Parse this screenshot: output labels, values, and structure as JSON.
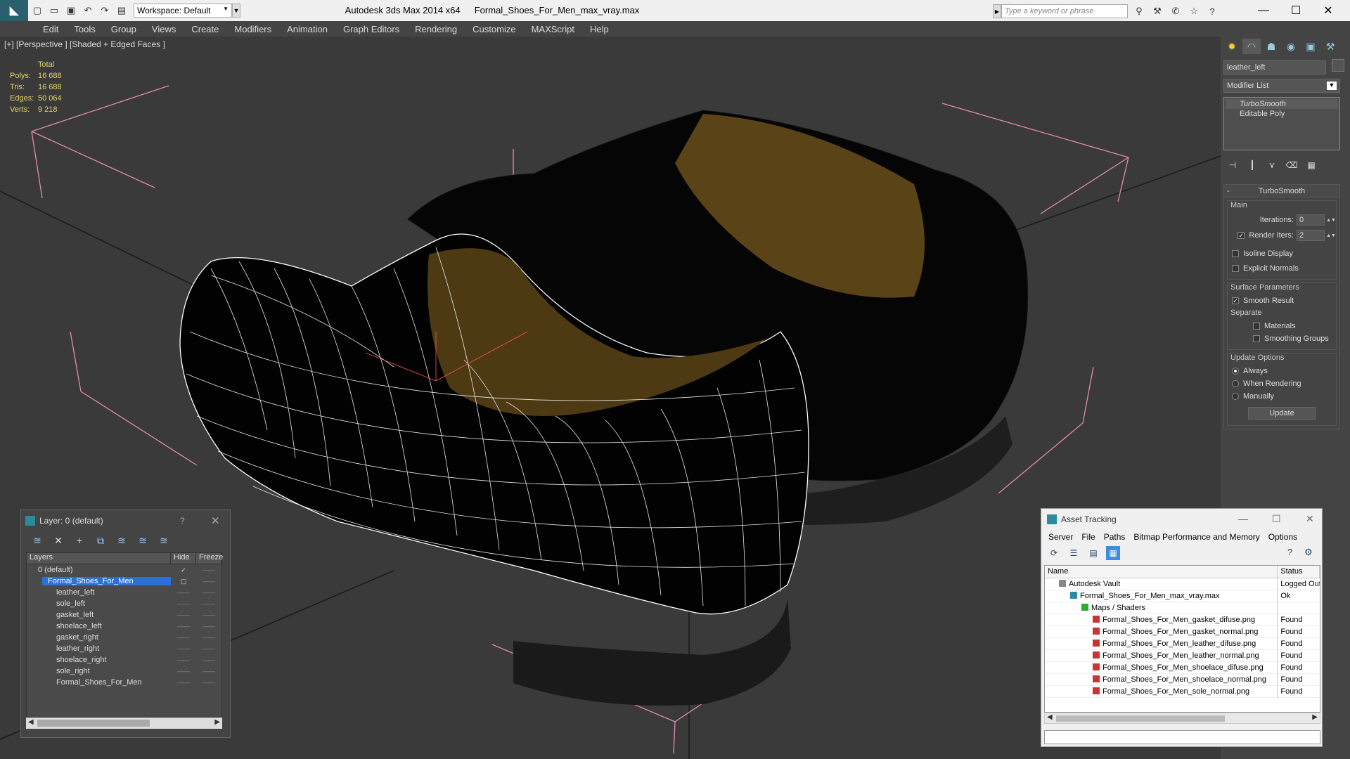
{
  "window": {
    "app_title": "Autodesk 3ds Max  2014 x64",
    "file_name": "Formal_Shoes_For_Men_max_vray.max",
    "workspace": "Workspace: Default",
    "search_placeholder": "Type a keyword or phrase"
  },
  "menu": [
    "Edit",
    "Tools",
    "Group",
    "Views",
    "Create",
    "Modifiers",
    "Animation",
    "Graph Editors",
    "Rendering",
    "Customize",
    "MAXScript",
    "Help"
  ],
  "viewport": {
    "label": "[+] [Perspective ] [Shaded + Edged Faces ]",
    "stats_header": "Total",
    "stats": [
      {
        "k": "Polys:",
        "v": "16 688"
      },
      {
        "k": "Tris:",
        "v": "16 688"
      },
      {
        "k": "Edges:",
        "v": "50 064"
      },
      {
        "k": "Verts:",
        "v": "9 218"
      }
    ]
  },
  "command_panel": {
    "object_name": "leather_left",
    "modifier_list": "Modifier List",
    "stack": [
      "TurboSmooth",
      "Editable Poly"
    ],
    "rollout_title": "TurboSmooth",
    "main_label": "Main",
    "iterations_label": "Iterations:",
    "iterations_value": "0",
    "render_iters_label": "Render Iters:",
    "render_iters_value": "2",
    "isoline_display": "Isoline Display",
    "explicit_normals": "Explicit Normals",
    "surface_params": "Surface Parameters",
    "smooth_result": "Smooth Result",
    "separate": "Separate",
    "materials": "Materials",
    "smoothing_groups": "Smoothing Groups",
    "update_options": "Update Options",
    "always": "Always",
    "when_rendering": "When Rendering",
    "manually": "Manually",
    "update_button": "Update"
  },
  "layer_panel": {
    "title": "Layer: 0 (default)",
    "help": "?",
    "col_layers": "Layers",
    "col_hide": "Hide",
    "col_freeze": "Freeze",
    "rows": [
      {
        "name": "0 (default)",
        "type": "layer"
      },
      {
        "name": "Formal_Shoes_For_Men",
        "type": "selected"
      },
      {
        "name": "leather_left",
        "type": "child"
      },
      {
        "name": "sole_left",
        "type": "child"
      },
      {
        "name": "gasket_left",
        "type": "child"
      },
      {
        "name": "shoelace_left",
        "type": "child"
      },
      {
        "name": "gasket_right",
        "type": "child"
      },
      {
        "name": "leather_right",
        "type": "child"
      },
      {
        "name": "shoelace_right",
        "type": "child"
      },
      {
        "name": "sole_right",
        "type": "child"
      },
      {
        "name": "Formal_Shoes_For_Men",
        "type": "child"
      }
    ]
  },
  "asset_panel": {
    "title": "Asset Tracking",
    "menu": [
      "Server",
      "File",
      "Paths",
      "Bitmap Performance and Memory",
      "Options"
    ],
    "col_name": "Name",
    "col_status": "Status",
    "rows": [
      {
        "name": "Autodesk Vault",
        "status": "Logged Out",
        "indent": 0,
        "icon": "vault"
      },
      {
        "name": "Formal_Shoes_For_Men_max_vray.max",
        "status": "Ok",
        "indent": 1,
        "icon": "max"
      },
      {
        "name": "Maps / Shaders",
        "status": "",
        "indent": 2,
        "icon": "maps"
      },
      {
        "name": "Formal_Shoes_For_Men_gasket_difuse.png",
        "status": "Found",
        "indent": 3,
        "icon": "png"
      },
      {
        "name": "Formal_Shoes_For_Men_gasket_normal.png",
        "status": "Found",
        "indent": 3,
        "icon": "png"
      },
      {
        "name": "Formal_Shoes_For_Men_leather_difuse.png",
        "status": "Found",
        "indent": 3,
        "icon": "png"
      },
      {
        "name": "Formal_Shoes_For_Men_leather_normal.png",
        "status": "Found",
        "indent": 3,
        "icon": "png"
      },
      {
        "name": "Formal_Shoes_For_Men_shoelace_difuse.png",
        "status": "Found",
        "indent": 3,
        "icon": "png"
      },
      {
        "name": "Formal_Shoes_For_Men_shoelace_normal.png",
        "status": "Found",
        "indent": 3,
        "icon": "png"
      },
      {
        "name": "Formal_Shoes_For_Men_sole_normal.png",
        "status": "Found",
        "indent": 3,
        "icon": "png"
      }
    ]
  }
}
